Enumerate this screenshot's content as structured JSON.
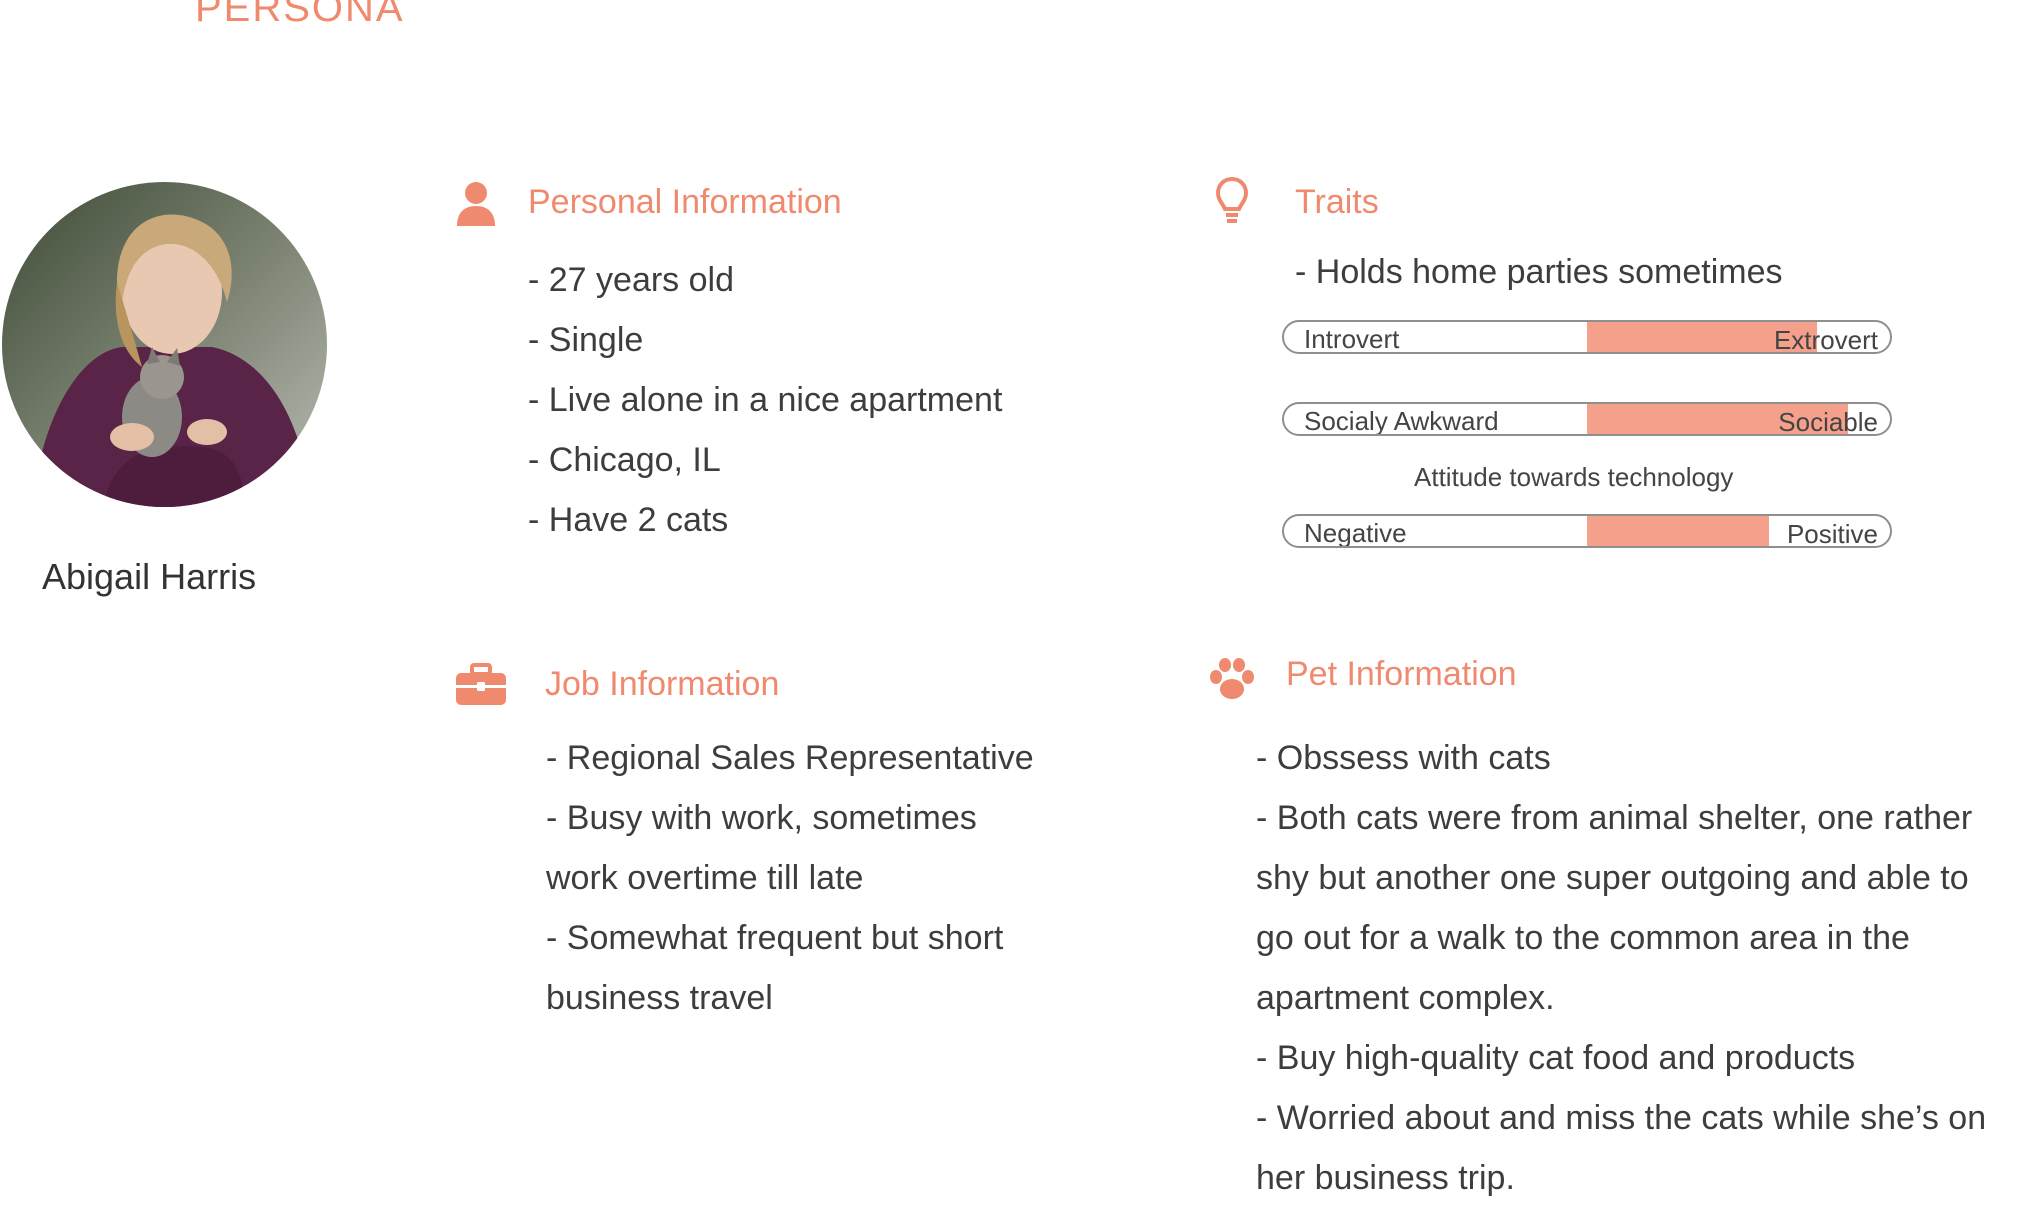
{
  "header": {
    "title": "PERSONA"
  },
  "profile": {
    "name": "Abigail Harris"
  },
  "personal": {
    "title": "Personal Information",
    "items": [
      "- 27 years old",
      "- Single",
      "- Live alone in a nice apartment",
      "- Chicago, IL",
      "- Have 2 cats"
    ]
  },
  "traits": {
    "title": "Traits",
    "note": "- Holds home parties sometimes",
    "bars": [
      {
        "left": "Introvert",
        "right": "Extrovert",
        "fill_start": 0.5,
        "fill_end": 0.88
      },
      {
        "left": "Socialy Awkward",
        "right": "Sociable",
        "fill_start": 0.5,
        "fill_end": 0.93
      },
      {
        "left": "Negative",
        "right": "Positive",
        "fill_start": 0.5,
        "fill_end": 0.8
      }
    ],
    "caption": "Attitude towards technology"
  },
  "job": {
    "title": "Job Information",
    "lines": [
      "- Regional Sales Representative",
      "- Busy with work, sometimes",
      "work overtime till late",
      "- Somewhat frequent but short",
      "business travel"
    ]
  },
  "pet": {
    "title": "Pet Information",
    "lines": [
      "- Obssess with cats",
      "- Both cats were from animal shelter, one rather",
      "shy but another one super outgoing and able to",
      "go out for a walk to the common area in the",
      "apartment complex.",
      "- Buy high-quality cat food and products",
      "- Worried about and miss the cats while she’s on",
      "her business trip."
    ]
  },
  "icons": {
    "personal": "person-icon",
    "traits": "lightbulb-icon",
    "job": "briefcase-icon",
    "pet": "paw-icon"
  },
  "colors": {
    "accent": "#f08a6e",
    "bar_fill": "#f4a08a"
  }
}
